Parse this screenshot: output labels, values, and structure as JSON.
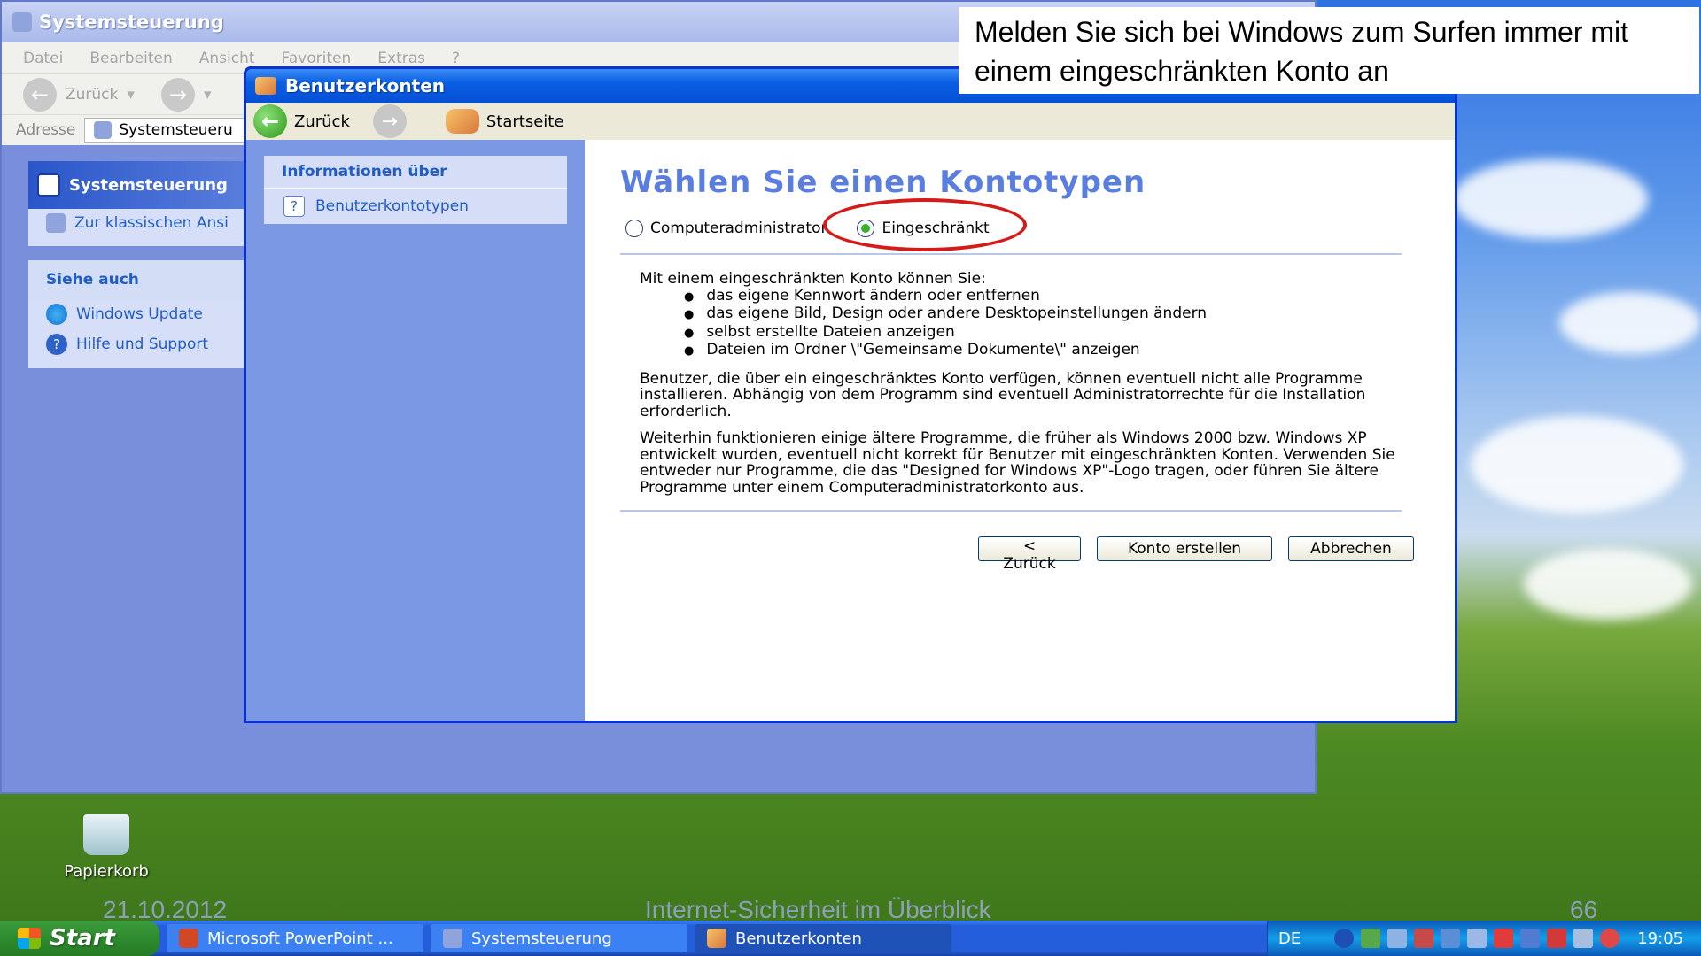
{
  "back_window": {
    "title": "Systemsteuerung",
    "menu": [
      "Datei",
      "Bearbeiten",
      "Ansicht",
      "Favoriten",
      "Extras",
      "?"
    ],
    "toolbar": {
      "back_label": "Zurück"
    },
    "address": {
      "label": "Adresse",
      "value": "Systemsteueru"
    },
    "left_pane": {
      "box1": {
        "title": "Systemsteuerung",
        "link": "Zur klassischen Ansi"
      },
      "box2": {
        "title": "Siehe auch",
        "links": [
          "Windows Update",
          "Hilfe und Support"
        ]
      }
    }
  },
  "dialog": {
    "title": "Benutzerkonten",
    "toolbar": {
      "back_label": "Zurück",
      "home_label": "Startseite"
    },
    "side": {
      "info_title": "Informationen über",
      "info_link": "Benutzerkontotypen"
    },
    "heading": "Wählen Sie einen Kontotypen",
    "options": [
      {
        "label": "Computeradministrator",
        "selected": false
      },
      {
        "label": "Eingeschränkt",
        "selected": true
      }
    ],
    "desc_intro": "Mit einem eingeschränkten Konto können Sie:",
    "desc_items": [
      "das eigene Kennwort ändern oder entfernen",
      "das eigene Bild, Design oder andere Desktopeinstellungen ändern",
      "selbst erstellte Dateien anzeigen",
      "Dateien im Ordner \\\"Gemeinsame Dokumente\\\" anzeigen"
    ],
    "para1": "Benutzer, die über ein eingeschränktes Konto verfügen, können eventuell nicht alle Programme installieren. Abhängig von dem Programm sind eventuell Administratorrechte für die Installation erforderlich.",
    "para2": "Weiterhin funktionieren einige ältere Programme, die früher als Windows 2000 bzw. Windows XP entwickelt wurden, eventuell nicht korrekt für Benutzer mit eingeschränkten Konten. Verwenden Sie entweder nur Programme, die das \"Designed for Windows XP\"-Logo tragen, oder führen Sie ältere Programme unter einem Computeradministratorkonto aus.",
    "buttons": {
      "back": "< Zurück",
      "create": "Konto erstellen",
      "cancel": "Abbrechen"
    }
  },
  "annotation": "Melden Sie sich bei Windows zum Surfen immer mit einem eingeschränkten Konto an",
  "desktop": {
    "recycle_bin": "Papierkorb"
  },
  "slide_footer": {
    "date": "21.10.2012",
    "title": "Internet-Sicherheit im Überblick",
    "page": "66"
  },
  "taskbar": {
    "start": "Start",
    "tasks": [
      "Microsoft PowerPoint ...",
      "Systemsteuerung",
      "Benutzerkonten"
    ],
    "language": "DE",
    "clock": "19:05"
  },
  "colors": {
    "accent_red": "#d51a1a",
    "xp_blue": "#0054e3",
    "heading_blue": "#5a7ee0",
    "link_blue": "#215dc6"
  }
}
